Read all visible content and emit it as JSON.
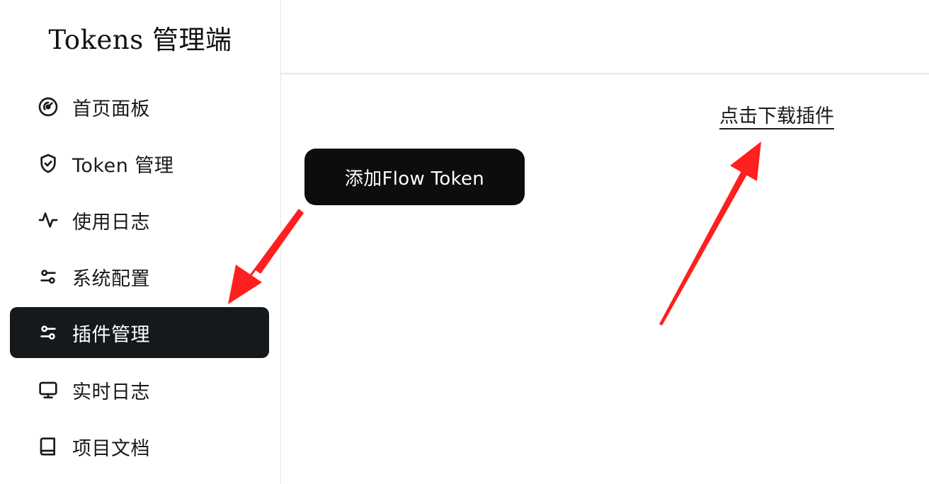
{
  "brand": {
    "title": "Tokens 管理端"
  },
  "sidebar": {
    "items": [
      {
        "label": "首页面板",
        "icon": "gauge-icon",
        "active": false
      },
      {
        "label": "Token 管理",
        "icon": "shield-check-icon",
        "active": false
      },
      {
        "label": "使用日志",
        "icon": "activity-icon",
        "active": false
      },
      {
        "label": "系统配置",
        "icon": "sliders-icon",
        "active": false
      },
      {
        "label": "插件管理",
        "icon": "sliders-icon",
        "active": true
      },
      {
        "label": "实时日志",
        "icon": "monitor-icon",
        "active": false
      },
      {
        "label": "项目文档",
        "icon": "book-icon",
        "active": false
      }
    ]
  },
  "main": {
    "add_button_label": "添加Flow Token",
    "download_link_label": "点击下载插件"
  },
  "colors": {
    "active_bg": "#15191c",
    "button_bg": "#0d0d0d",
    "annotation_arrow": "#ff1f1f"
  }
}
